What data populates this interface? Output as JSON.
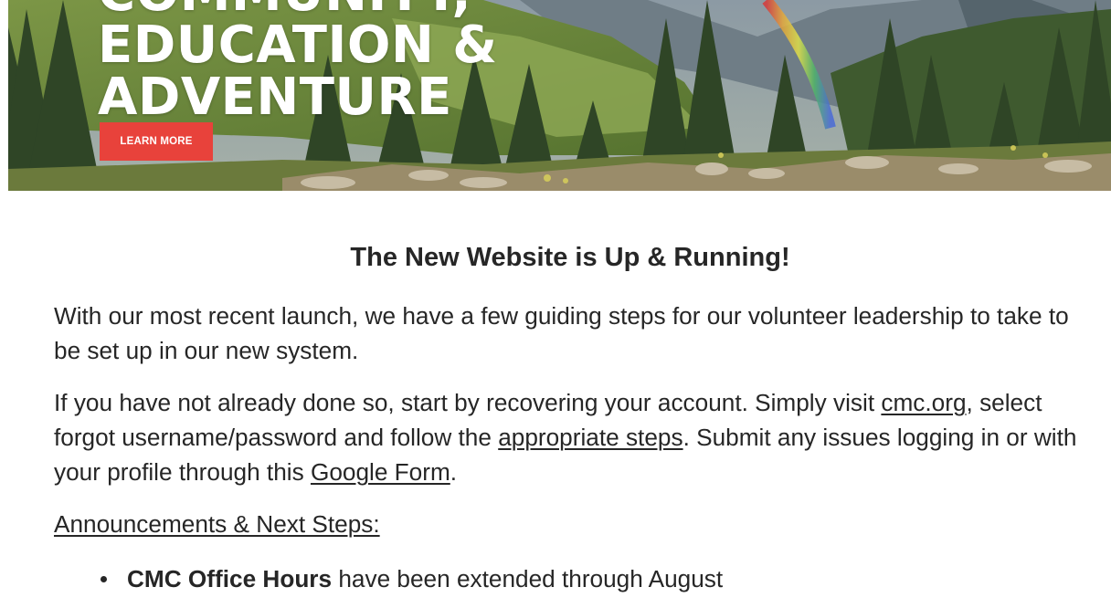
{
  "hero": {
    "headline_lines": [
      "COMMUNITY,",
      "EDUCATION &",
      "ADVENTURE"
    ],
    "cta_label": "LEARN MORE",
    "cta_color": "#e8423b"
  },
  "article": {
    "title": "The New Website is Up & Running!",
    "intro": "With our most recent launch, we have a few guiding steps for our volunteer leadership to take to be set up in our new system.",
    "recovery": {
      "text_1": "If you have not already done so, start by recovering your account. Simply visit ",
      "link_site": "cmc.org",
      "text_2": ", select forgot username/password and follow the ",
      "link_steps": "appropriate steps",
      "text_3": ". Submit any issues logging in or with your profile through this ",
      "link_form": "Google Form",
      "text_4": "."
    },
    "announcements_heading": "Announcements & Next Steps:",
    "bullets": [
      {
        "bold": "CMC Office Hours",
        "rest": " have been extended through August"
      }
    ]
  }
}
